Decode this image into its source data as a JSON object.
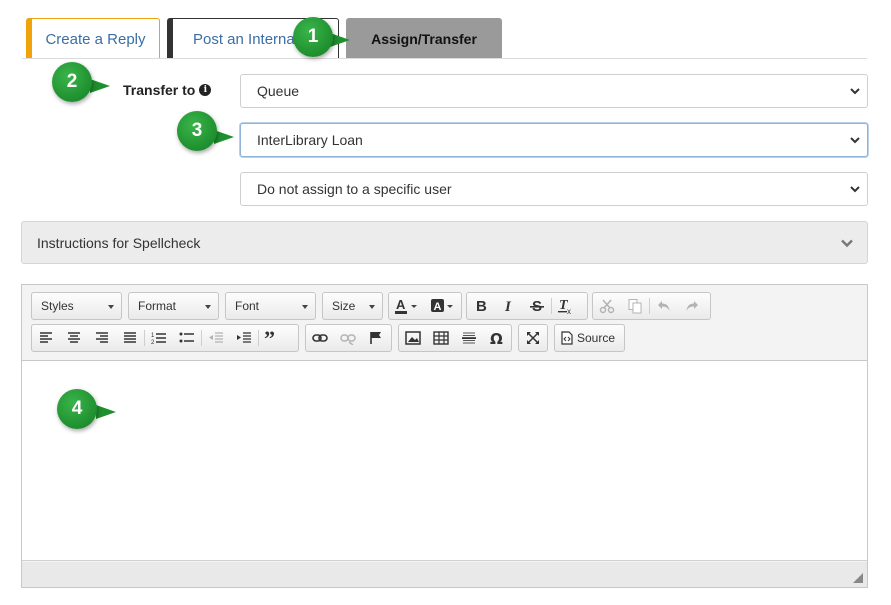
{
  "tabs": {
    "reply": "Create a Reply",
    "internal": "Post an Internal",
    "assign": "Assign/Transfer"
  },
  "callouts": [
    "1",
    "2",
    "3",
    "4"
  ],
  "transfer": {
    "label": "Transfer to",
    "info_icon": "i",
    "queue_select": "Queue",
    "target_select": "InterLibrary Loan",
    "user_select": "Do not assign to a specific user"
  },
  "accordion": {
    "label": "Instructions for Spellcheck"
  },
  "editor": {
    "combos": {
      "styles": "Styles",
      "format": "Format",
      "font": "Font",
      "size": "Size"
    },
    "source_label": "Source"
  },
  "colors": {
    "accent_orange": "#f0a30a",
    "callout_green": "#1e8f2e",
    "tab_active_bg": "#9a9a9a",
    "link_blue": "#3a6ea5"
  }
}
